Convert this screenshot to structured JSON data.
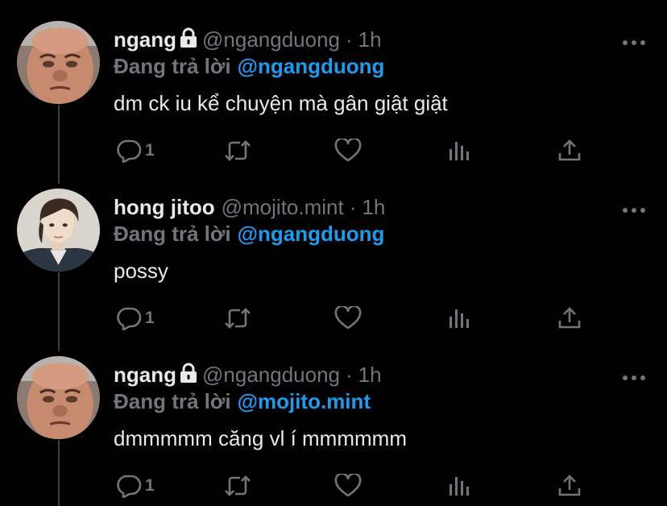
{
  "colors": {
    "background": "#000000",
    "text": "#e7e9ea",
    "muted": "#71767b",
    "accent": "#1d9bf0",
    "thread_line": "#3e4144"
  },
  "tweets": [
    {
      "display_name": "ngang",
      "locked": true,
      "handle": "@ngangduong",
      "separator": "·",
      "time": "1h",
      "reply_label": "Đang trả lời",
      "reply_to": "@ngangduong",
      "text": "dm ck iu kể chuyện mà gân giật giật",
      "reply_count": "1",
      "avatar_icon": "man-face-avatar"
    },
    {
      "display_name": "hong jitoo",
      "locked": false,
      "handle": "@mojito.mint",
      "separator": "·",
      "time": "1h",
      "reply_label": "Đang trả lời",
      "reply_to": "@ngangduong",
      "text": "possy",
      "reply_count": "1",
      "avatar_icon": "young-man-avatar"
    },
    {
      "display_name": "ngang",
      "locked": true,
      "handle": "@ngangduong",
      "separator": "·",
      "time": "1h",
      "reply_label": "Đang trả lời",
      "reply_to": "@mojito.mint",
      "text": "dmmmmm căng vl í mmmmmm",
      "reply_count": "1",
      "avatar_icon": "man-face-avatar"
    }
  ],
  "icons": {
    "more": "more-options-icon",
    "reply": "reply-bubble-icon",
    "retweet": "retweet-icon",
    "like": "heart-icon",
    "views": "analytics-icon",
    "share": "share-icon"
  }
}
